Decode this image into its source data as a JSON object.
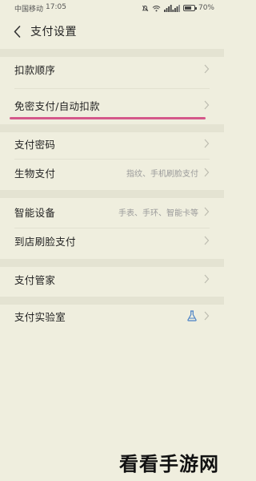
{
  "status_bar": {
    "carrier": "中国移动",
    "time": "17:05",
    "battery": "70%"
  },
  "header": {
    "title": "支付设置"
  },
  "settings": {
    "deduct_order": {
      "label": "扣款顺序"
    },
    "autopay": {
      "label": "免密支付/自动扣款"
    },
    "password": {
      "label": "支付密码"
    },
    "biometric": {
      "label": "生物支付",
      "detail": "指纹、手机刷脸支付"
    },
    "smart_devices": {
      "label": "智能设备",
      "detail": "手表、手环、智能卡等"
    },
    "face_pay_store": {
      "label": "到店刷脸支付"
    },
    "manager": {
      "label": "支付管家"
    },
    "lab": {
      "label": "支付实验室"
    }
  },
  "icons": {
    "back": "chevron-left-icon",
    "row_arrow": "chevron-right-icon",
    "lab": "flask-icon"
  },
  "colors": {
    "background": "#efeede",
    "highlight": "#d4588a",
    "lab_icon": "#4a82c6"
  },
  "watermark": "看看手游网"
}
